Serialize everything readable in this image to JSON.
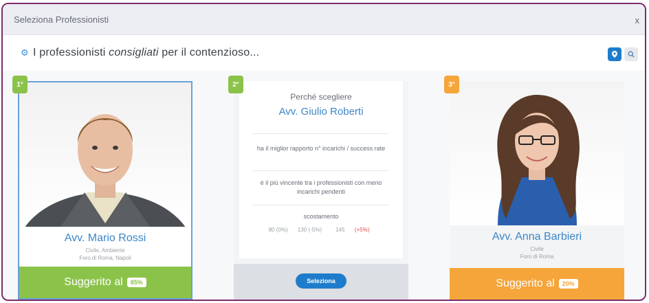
{
  "window": {
    "title": "Seleziona Professionisti",
    "close": "x"
  },
  "header": {
    "text_before": "I professionisti ",
    "text_italic": "consigliati",
    "text_after": " per il contenzioso",
    "ellipsis": "..."
  },
  "cards": [
    {
      "rank": "1°",
      "name": "Avv. Mario Rossi",
      "line1": "Civile, Ambiente",
      "line2": "Foro di Roma, Napoli",
      "suggested_label": "Suggerito al",
      "suggested_pct": "85%"
    },
    {
      "rank": "2°",
      "why": "Perché scegliere",
      "lawyer": "Avv. Giulio Roberti",
      "reason1": "ha il miglior rapporto n° incarichi / success rate",
      "reason2": "è il più vincente tra i professionisti con meno incarichi pendenti",
      "scostamento": "scostamento",
      "stats": [
        "80 (0%)",
        "130 (-5%)"
      ],
      "stat_third_value": "145",
      "stat_third_delta": "(+5%)",
      "select_label": "Seleziona"
    },
    {
      "rank": "3°",
      "name": "Avv. Anna Barbieri",
      "line1": "Civile",
      "line2": "Foro di Roma",
      "suggested_label": "Suggerito al",
      "suggested_pct": "20%"
    }
  ],
  "colors": {
    "green": "#8bc34a",
    "orange": "#f5a53a",
    "blue": "#1f7ccc",
    "border_purple": "#7d2a6c"
  }
}
